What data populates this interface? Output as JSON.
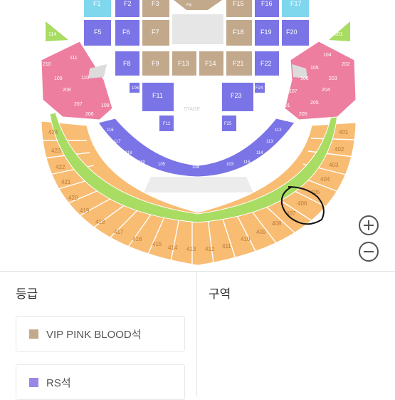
{
  "colors": {
    "vip": "#c3a98c",
    "rs": "#9b86e8",
    "blue": "#7a74e6",
    "pink": "#ee7ea0",
    "green": "#a8dc62",
    "orange": "#f8bc72",
    "cyan": "#7fd7ee",
    "stage": "#e6e6e6",
    "annotation": "#111111"
  },
  "floor": {
    "top_row": [
      "F1",
      "F2",
      "F3",
      "F4",
      "F15",
      "F16",
      "F17"
    ],
    "row2": [
      "F5",
      "F6",
      "F7",
      "F18",
      "F19",
      "F20"
    ],
    "row3": [
      "F8",
      "F9",
      "F13",
      "F14",
      "F21",
      "F22"
    ],
    "lower": [
      "F11",
      "F23",
      "F12",
      "F25",
      "106",
      "F24"
    ]
  },
  "stage_label": "STAGE",
  "pink_sections": [
    "112",
    "111",
    "110",
    "109",
    "108",
    "207",
    "206",
    "210",
    "209",
    "208",
    "102",
    "103",
    "104",
    "105",
    "106",
    "107",
    "201",
    "202",
    "203",
    "204",
    "205"
  ],
  "green_sections": [
    "114",
    "101"
  ],
  "blue_sections": [
    "116",
    "117",
    "118",
    "119",
    "105",
    "104",
    "103",
    "120",
    "115",
    "114",
    "113",
    "112",
    "111"
  ],
  "orange_sections": [
    "424",
    "423",
    "422",
    "421",
    "420",
    "419",
    "418",
    "417",
    "416",
    "415",
    "414",
    "413",
    "412",
    "411",
    "410",
    "409",
    "408",
    "407",
    "406",
    "405",
    "404",
    "403",
    "402",
    "401"
  ],
  "annotated_section": "406",
  "zoom": {
    "in_icon": "plus-icon",
    "out_icon": "minus-icon"
  },
  "panel": {
    "grade_title": "등급",
    "zone_title": "구역",
    "grades": [
      {
        "name": "VIP PINK BLOOD석",
        "color": "#c3a98c"
      },
      {
        "name": "RS석",
        "color": "#9b86e8"
      }
    ]
  }
}
